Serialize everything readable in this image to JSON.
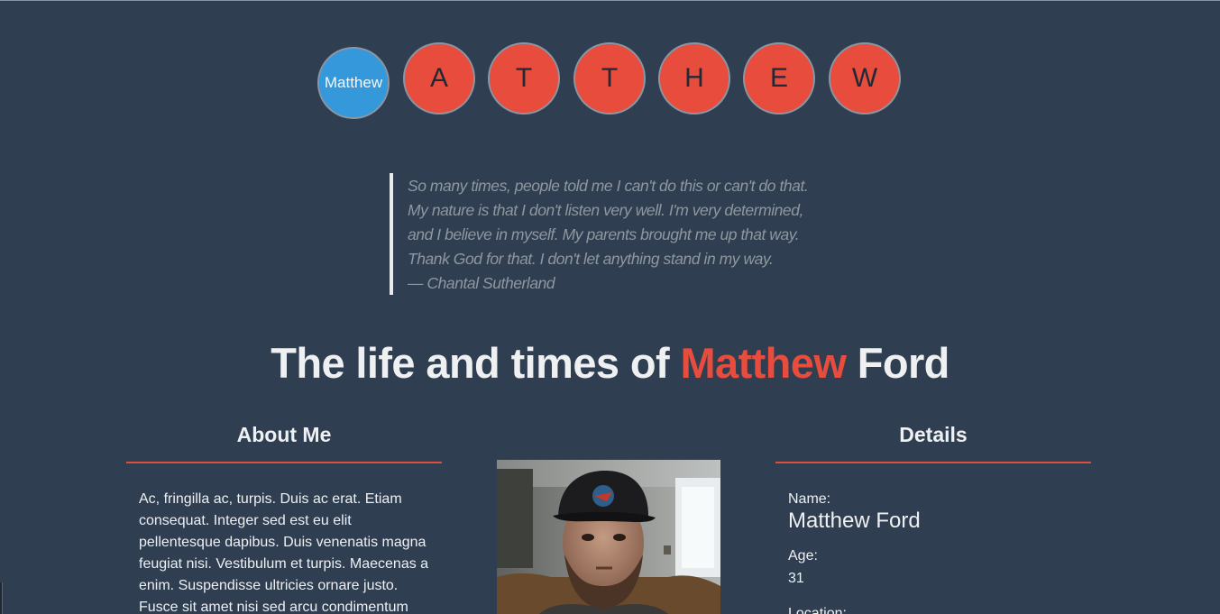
{
  "nav": {
    "circles": [
      {
        "label": "Matthew",
        "style": "blue"
      },
      {
        "label": "A",
        "style": "red"
      },
      {
        "label": "T",
        "style": "red"
      },
      {
        "label": "T",
        "style": "red"
      },
      {
        "label": "H",
        "style": "red"
      },
      {
        "label": "E",
        "style": "red"
      },
      {
        "label": "W",
        "style": "red"
      }
    ]
  },
  "quote": {
    "text": "So many times, people told me I can't do this or can't do that. My nature is that I don't listen very well. I'm very determined, and I believe in myself. My parents brought me up that way. Thank God for that. I don't let anything stand in my way.",
    "author": "— Chantal Sutherland"
  },
  "title": {
    "prefix": "The life and times of ",
    "accent": "Matthew",
    "suffix": " Ford"
  },
  "about": {
    "heading": "About Me",
    "body": "Ac, fringilla ac, turpis. Duis ac erat. Etiam consequat. Integer sed est eu elit pellentesque dapibus. Duis venenatis magna feugiat nisi. Vestibulum et turpis. Maecenas a enim. Suspendisse ultricies ornare justo. Fusce sit amet nisi sed arcu condimentum"
  },
  "details": {
    "heading": "Details",
    "name_label": "Name:",
    "name_value": "Matthew Ford",
    "age_label": "Age:",
    "age_value": "31",
    "location_label": "Location:"
  },
  "colors": {
    "background": "#2f3e51",
    "accent_red": "#e74c3c",
    "accent_blue": "#3498db"
  }
}
